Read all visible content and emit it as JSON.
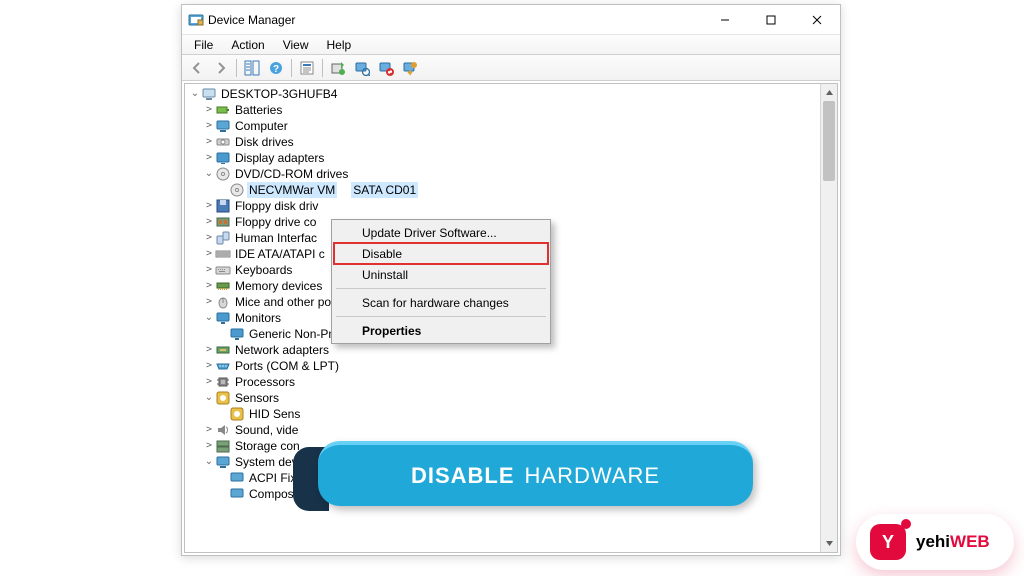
{
  "window": {
    "title": "Device Manager"
  },
  "menu": {
    "file": "File",
    "action": "Action",
    "view": "View",
    "help": "Help"
  },
  "tree": {
    "root": "DESKTOP-3GHUFB4",
    "batteries": "Batteries",
    "computer": "Computer",
    "disk_drives": "Disk drives",
    "display_adapters": "Display adapters",
    "dvd": "DVD/CD-ROM drives",
    "dvd_child": "NECVMWar VM",
    "dvd_child_tail": "SATA CD01",
    "floppy_drives": "Floppy disk driv",
    "floppy_ctrl": "Floppy drive co",
    "hid": "Human Interfac",
    "ide": "IDE ATA/ATAPI c",
    "keyboards": "Keyboards",
    "memory": "Memory devices",
    "mice": "Mice and other pointing devices",
    "monitors": "Monitors",
    "monitors_child": "Generic Non-PnP Monitor",
    "network": "Network adapters",
    "ports": "Ports (COM & LPT)",
    "processors": "Processors",
    "sensors": "Sensors",
    "sensors_child": "HID Sens",
    "sound": "Sound, vide",
    "storage": "Storage con",
    "system": "System dev",
    "system_acpi": "ACPI Fixed Feature Button",
    "system_composite": "Composite Bus Enumerator"
  },
  "context_menu": {
    "update": "Update Driver Software...",
    "disable": "Disable",
    "uninstall": "Uninstall",
    "scan": "Scan for hardware changes",
    "properties": "Properties"
  },
  "banner": {
    "bold": "DISABLE",
    "rest": "HARDWARE"
  },
  "brand": {
    "name_black": "yehi",
    "name_red": "WEB",
    "logo_letter": "Y"
  }
}
